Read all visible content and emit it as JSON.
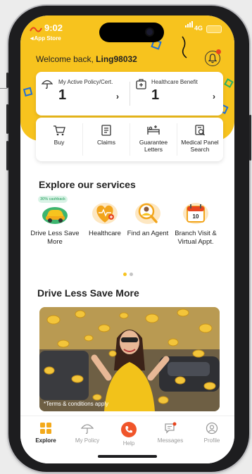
{
  "status_bar": {
    "time": "9:02",
    "back_label": "App Store",
    "network": "4G"
  },
  "header": {
    "welcome_prefix": "Welcome back, ",
    "username": "Ling98032"
  },
  "policy_card": {
    "active_policy": {
      "label": "My Active Policy/Cert.",
      "count": "1"
    },
    "healthcare_benefit": {
      "label": "Healthcare Benefit",
      "count": "1"
    }
  },
  "quick_actions": [
    {
      "label": "Buy",
      "icon": "cart-icon"
    },
    {
      "label": "Claims",
      "icon": "claims-document-icon"
    },
    {
      "label": "Guarantee Letters",
      "icon": "hospital-bed-icon"
    },
    {
      "label": "Medical Panel Search",
      "icon": "medical-search-icon"
    }
  ],
  "services": {
    "title": "Explore our services",
    "items": [
      {
        "label": "Drive Less Save More",
        "badge": "30% cashback",
        "icon": "car-icon"
      },
      {
        "label": "Healthcare",
        "icon": "heart-icon"
      },
      {
        "label": "Find an Agent",
        "icon": "agent-search-icon"
      },
      {
        "label": "Branch Visit & Virtual Appt.",
        "icon": "calendar-icon"
      }
    ],
    "calendar_day": "10",
    "page_count": 2,
    "active_page": 1
  },
  "promo": {
    "title": "Drive Less Save More",
    "terms": "*Terms & conditions apply"
  },
  "tabs": [
    {
      "label": "Explore",
      "icon": "grid-icon",
      "active": true
    },
    {
      "label": "My Policy",
      "icon": "umbrella-icon",
      "active": false
    },
    {
      "label": "Help",
      "icon": "phone-icon",
      "active": false
    },
    {
      "label": "Messages",
      "icon": "message-icon",
      "active": false
    },
    {
      "label": "Profile",
      "icon": "profile-icon",
      "active": false
    }
  ],
  "colors": {
    "brand": "#f7c31e",
    "accent": "#f0552a",
    "inactive": "#9a9a9a"
  }
}
